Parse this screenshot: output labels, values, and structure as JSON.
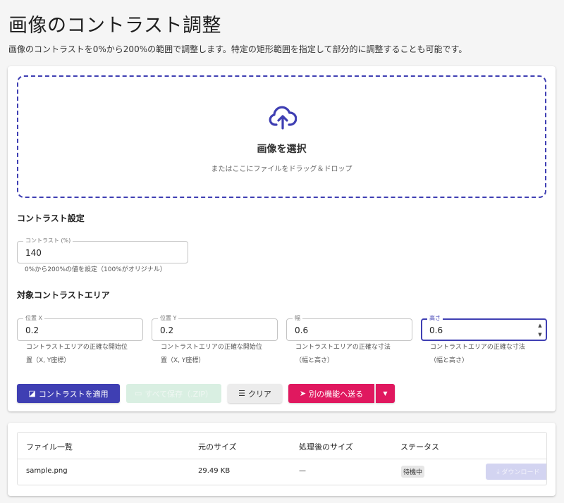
{
  "page": {
    "title": "画像のコントラスト調整",
    "description": "画像のコントラストを0%から200%の範囲で調整します。特定の矩形範囲を指定して部分的に調整することも可能です。"
  },
  "dropzone": {
    "icon": "cloud-upload-icon",
    "title": "画像を選択",
    "subtitle": "またはここにファイルをドラッグ＆ドロップ"
  },
  "contrast": {
    "section_title": "コントラスト設定",
    "field_label": "コントラスト (%)",
    "value": "140",
    "helper": "0%から200%の値を設定（100%がオリジナル）"
  },
  "area": {
    "section_title": "対象コントラストエリア",
    "fields": [
      {
        "label": "位置 X",
        "value": "0.2",
        "helper_line1": "コントラストエリアの正確な開始位",
        "helper_line2": "置（X, Y座標）"
      },
      {
        "label": "位置 Y",
        "value": "0.2",
        "helper_line1": "コントラストエリアの正確な開始位",
        "helper_line2": "置（X, Y座標）"
      },
      {
        "label": "幅",
        "value": "0.6",
        "helper_line1": "コントラストエリアの正確な寸法",
        "helper_line2": "（幅と高さ）"
      },
      {
        "label": "高さ",
        "value": "0.6",
        "helper_line1": "コントラストエリアの正確な寸法",
        "helper_line2": "（幅と高さ）"
      }
    ]
  },
  "actions": {
    "apply_label": "コントラストを適用",
    "save_all_label": "すべて保存（.ZIP）",
    "clear_label": "クリア",
    "send_label": "別の機能へ送る",
    "icons": {
      "apply": "contrast-icon",
      "save": "folder-icon",
      "clear": "clear-list-icon",
      "send": "send-icon",
      "menu": "caret-down-icon"
    }
  },
  "table": {
    "headers": [
      "ファイル一覧",
      "元のサイズ",
      "処理後のサイズ",
      "ステータス"
    ],
    "rows": [
      {
        "file": "sample.png",
        "original_size": "29.49 KB",
        "processed_size": "—",
        "status": "待機中",
        "download_label": "ダウンロード"
      }
    ]
  },
  "colors": {
    "primary": "#3f3fb3",
    "accent": "#e0185f",
    "disabled_green": "#d9efe2"
  }
}
